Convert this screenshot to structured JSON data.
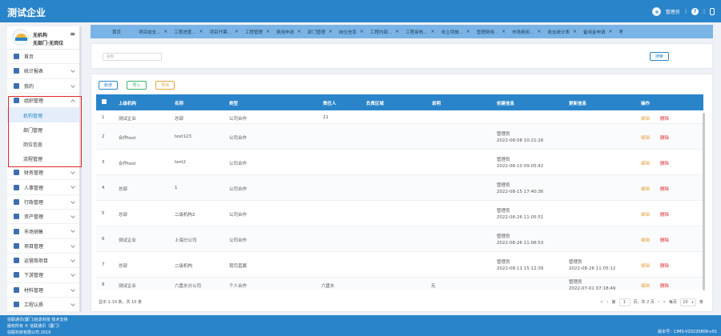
{
  "header": {
    "app_title": "测试企业",
    "user_label": "管理员",
    "help_icon": "question-circle-icon",
    "mobile_icon": "mobile-phone-icon",
    "separator": "|"
  },
  "sidebar": {
    "org_name": "无机构",
    "dept_name": "无部门·无岗位",
    "menu_icon": "hamburger-icon",
    "items": [
      {
        "label": "首页",
        "icon": "home-icon",
        "has_children": false
      },
      {
        "label": "统计报表",
        "icon": "chart-icon",
        "has_children": true
      },
      {
        "label": "我的",
        "icon": "user-icon",
        "has_children": true
      },
      {
        "label": "组织管理",
        "icon": "org-icon",
        "has_children": true,
        "open": true,
        "children": [
          "机构管理",
          "部门管理",
          "岗位信息",
          "流程管理"
        ],
        "active_child": 0
      },
      {
        "label": "财务管理",
        "icon": "finance-icon",
        "has_children": true
      },
      {
        "label": "人事管理",
        "icon": "people-icon",
        "has_children": true
      },
      {
        "label": "行政管理",
        "icon": "admin-icon",
        "has_children": true
      },
      {
        "label": "资产管理",
        "icon": "asset-icon",
        "has_children": true
      },
      {
        "label": "市场销售",
        "icon": "market-icon",
        "has_children": true
      },
      {
        "label": "项目管理",
        "icon": "project-icon",
        "has_children": true
      },
      {
        "label": "运营商项目",
        "icon": "operator-icon",
        "has_children": true
      },
      {
        "label": "下游管理",
        "icon": "downstream-icon",
        "has_children": true
      },
      {
        "label": "材料管理",
        "icon": "material-icon",
        "has_children": true
      },
      {
        "label": "工程认质",
        "icon": "engineering-icon",
        "has_children": true
      }
    ]
  },
  "tabs": [
    {
      "label": "首页",
      "closable": false
    },
    {
      "label": "项目收支...",
      "closable": true
    },
    {
      "label": "工程进度...",
      "closable": true
    },
    {
      "label": "项目开票...",
      "closable": true
    },
    {
      "label": "工程管理",
      "closable": true
    },
    {
      "label": "费用申请",
      "closable": true
    },
    {
      "label": "部门管理",
      "closable": true
    },
    {
      "label": "岗位信息",
      "closable": true
    },
    {
      "label": "工程内部...",
      "closable": true
    },
    {
      "label": "工程审核...",
      "closable": true
    },
    {
      "label": "未立项施...",
      "closable": true
    },
    {
      "label": "管理费用...",
      "closable": true
    },
    {
      "label": "市场费用...",
      "closable": true
    },
    {
      "label": "收支统计表",
      "closable": true
    },
    {
      "label": "备用金申请",
      "closable": true
    },
    {
      "label": "考",
      "closable": false
    }
  ],
  "tab_close_glyph": "×",
  "search": {
    "placeholder": "名称",
    "button_label": "搜索"
  },
  "toolbar": {
    "add_label": "新增",
    "import_label": "导入",
    "export_label": "导出"
  },
  "table": {
    "columns": [
      "上级机构",
      "名称",
      "类型",
      "责任人",
      "负责区域",
      "说明",
      "创建信息",
      "更新信息",
      "操作"
    ],
    "edit_label": "编辑",
    "delete_label": "删除",
    "rows": [
      {
        "no": "1",
        "parent": "测试企业",
        "name": "总部",
        "type": "公司合作",
        "owner": "21",
        "region": "",
        "desc": "",
        "created_by": "",
        "created_at": "",
        "updated_by": "",
        "updated_at": ""
      },
      {
        "no": "2",
        "parent": "合作test",
        "name": "test123",
        "type": "公司合作",
        "owner": "",
        "region": "",
        "desc": "",
        "created_by": "管理员",
        "created_at": "2022-08-08 10:21:16",
        "updated_by": "",
        "updated_at": ""
      },
      {
        "no": "3",
        "parent": "合作test",
        "name": "test2",
        "type": "公司合作",
        "owner": "",
        "region": "",
        "desc": "",
        "created_by": "管理员",
        "created_at": "2022-08-10 09:05:42",
        "updated_by": "",
        "updated_at": ""
      },
      {
        "no": "4",
        "parent": "总部",
        "name": "1",
        "type": "公司合作",
        "owner": "",
        "region": "",
        "desc": "",
        "created_by": "管理员",
        "created_at": "2022-08-15 17:40:36",
        "updated_by": "",
        "updated_at": ""
      },
      {
        "no": "5",
        "parent": "总部",
        "name": "二级机构2",
        "type": "公司合作",
        "owner": "",
        "region": "",
        "desc": "",
        "created_by": "管理员",
        "created_at": "2022-08-26 11:05:51",
        "updated_by": "",
        "updated_at": ""
      },
      {
        "no": "6",
        "parent": "测试企业",
        "name": "上海分公司",
        "type": "公司合作",
        "owner": "",
        "region": "",
        "desc": "",
        "created_by": "管理员",
        "created_at": "2022-08-26 11:06:53",
        "updated_by": "",
        "updated_at": ""
      },
      {
        "no": "7",
        "parent": "总部",
        "name": "二级机构",
        "type": "我司直属",
        "owner": "",
        "region": "",
        "desc": "",
        "created_by": "管理员",
        "created_at": "2022-08-11 15:12:39",
        "updated_by": "管理员",
        "updated_at": "2022-08-26 11:05:12"
      },
      {
        "no": "8",
        "parent": "测试企业",
        "name": "六盘水分公司",
        "type": "个人合作",
        "owner": "",
        "region": "六盘水",
        "desc": "无",
        "created_by": "",
        "created_at": "",
        "updated_by": "管理员",
        "updated_at": "2022-07-01 07:18:49"
      }
    ]
  },
  "pagination": {
    "summary": "显示 1-10 条，共 10 条",
    "first": "«",
    "prev": "‹",
    "page_prefix": "第",
    "page": "1",
    "page_suffix": "页，共 2 页",
    "next": "›",
    "last": "»",
    "page_size_prefix": "每页",
    "page_size": "10",
    "page_size_suffix": "条"
  },
  "footer": {
    "line1": "信联通讯(厦门)信息科技 技术支持",
    "line2": "版权所有 © 信联通讯（厦门）",
    "line3": "信联科技有限公司 2019",
    "version": "版本号：CIMS-V20220808-v01"
  },
  "colors": {
    "primary": "#2a84c9",
    "tab_bar": "#7ab4e6",
    "edit": "#e7a33e",
    "delete": "#e0262a",
    "import": "#3cb371",
    "highlight_box": "#e0262a"
  }
}
